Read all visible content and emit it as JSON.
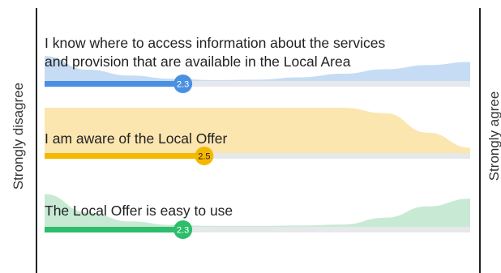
{
  "chart_data": {
    "type": "bar",
    "scale": {
      "min": 1,
      "max": 5,
      "min_label": "Strongly disagree",
      "max_label": "Strongly agree"
    },
    "series": [
      {
        "name": "I know where to access information about the services and provision that are available in the Local Area",
        "lines": [
          "I know where to access information about the services",
          "and provision that are available in the Local Area"
        ],
        "mean": 2.3,
        "mean_label": "2.3",
        "color": "#4a90e2",
        "track_color": "#e6e8ea",
        "area_color": "#c6dcf4",
        "distribution": [
          0.55,
          0.25,
          0.12,
          0.05,
          0.02,
          0.03,
          0.08,
          0.16,
          0.26,
          0.35,
          0.42
        ]
      },
      {
        "name": "I am aware of the Local Offer",
        "lines": [
          "I am aware of the Local Offer"
        ],
        "mean": 2.5,
        "mean_label": "2.5",
        "color": "#f5b800",
        "track_color": "#e6e8ea",
        "area_color": "#fbe6b0",
        "distribution": [
          1.0,
          1.0,
          1.0,
          1.0,
          1.0,
          1.0,
          1.0,
          1.0,
          0.88,
          0.45,
          0.12
        ]
      },
      {
        "name": "The Local Offer is easy to use",
        "lines": [
          "The Local Offer is easy to use"
        ],
        "mean": 2.3,
        "mean_label": "2.3",
        "color": "#2ebd6b",
        "track_color": "#e6e8ea",
        "area_color": "#c8ead5",
        "distribution": [
          0.72,
          0.32,
          0.12,
          0.04,
          0.02,
          0.02,
          0.03,
          0.05,
          0.2,
          0.45,
          0.62
        ]
      }
    ]
  }
}
